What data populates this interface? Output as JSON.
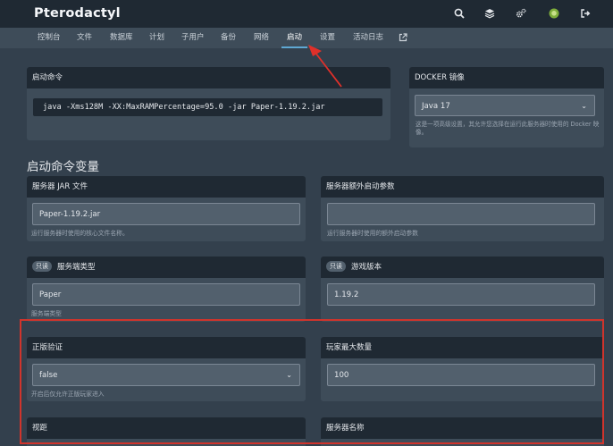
{
  "app": {
    "title": "Pterodactyl"
  },
  "topbar_icons": [
    "search-icon",
    "layers-icon",
    "gears-icon",
    "avatar",
    "logout-icon"
  ],
  "subnav": {
    "items": [
      "控制台",
      "文件",
      "数据库",
      "计划",
      "子用户",
      "备份",
      "网络",
      "启动",
      "设置",
      "活动日志"
    ],
    "active": "启动",
    "external_icon": "external-link-icon"
  },
  "startup": {
    "header": "启动命令",
    "command": "java -Xms128M -XX:MaxRAMPercentage=95.0 -jar Paper-1.19.2.jar"
  },
  "docker": {
    "header": "DOCKER 镜像",
    "selected": "Java 17",
    "description": "这是一项高级设置，其允许您选择在运行此服务器时使用的 Docker 映像。"
  },
  "variables_title": "启动命令变量",
  "variables": [
    {
      "label": "服务器 JAR 文件",
      "readonly": false,
      "value": "Paper-1.19.2.jar",
      "description": "运行服务器时使用的核心文件名称。"
    },
    {
      "label": "服务器额外启动参数",
      "readonly": false,
      "value": "",
      "description": "运行服务器时使用的额外启动参数"
    },
    {
      "label": "服务端类型",
      "readonly": true,
      "value": "Paper",
      "description": "服务端类型"
    },
    {
      "label": "游戏版本",
      "readonly": true,
      "value": "1.19.2",
      "description": ""
    },
    {
      "label": "正版验证",
      "readonly": false,
      "value": "false",
      "description": "开启后仅允许正版玩家进入",
      "select": true
    },
    {
      "label": "玩家最大数量",
      "readonly": false,
      "value": "100",
      "description": ""
    },
    {
      "label": "视距",
      "readonly": false,
      "value": "",
      "description": ""
    },
    {
      "label": "服务器名称",
      "readonly": false,
      "value": "",
      "description": ""
    }
  ],
  "readonly_badge": "只读",
  "colors": {
    "topbar": "#1f2933",
    "subnav": "#3e4c59",
    "accent": "#5fa8d3",
    "annotation": "#d0342c"
  }
}
